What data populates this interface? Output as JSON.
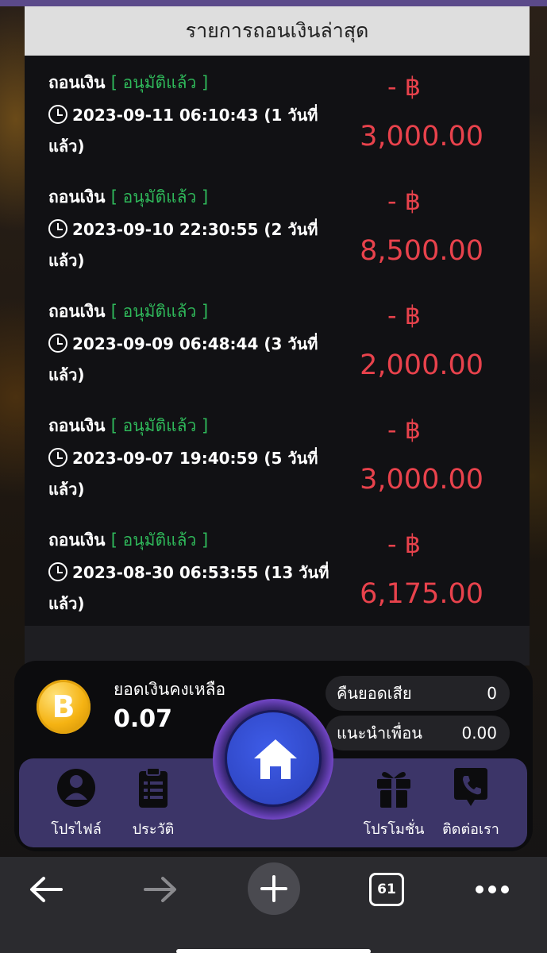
{
  "header": {
    "title": "รายการถอนเงินล่าสุด"
  },
  "transactions": [
    {
      "type": "ถอนเงิน",
      "status": "[ อนุมัติแล้ว ]",
      "datetime": "2023-09-11 06:10:43",
      "ago": "(1 วันที่แล้ว)",
      "sign": "- ฿",
      "amount": "3,000.00"
    },
    {
      "type": "ถอนเงิน",
      "status": "[ อนุมัติแล้ว ]",
      "datetime": "2023-09-10 22:30:55",
      "ago": "(2 วันที่แล้ว)",
      "sign": "- ฿",
      "amount": "8,500.00"
    },
    {
      "type": "ถอนเงิน",
      "status": "[ อนุมัติแล้ว ]",
      "datetime": "2023-09-09 06:48:44",
      "ago": "(3 วันที่แล้ว)",
      "sign": "- ฿",
      "amount": "2,000.00"
    },
    {
      "type": "ถอนเงิน",
      "status": "[ อนุมัติแล้ว ]",
      "datetime": "2023-09-07 19:40:59",
      "ago": "(5 วันที่แล้ว)",
      "sign": "- ฿",
      "amount": "3,000.00"
    },
    {
      "type": "ถอนเงิน",
      "status": "[ อนุมัติแล้ว ]",
      "datetime": "2023-08-30 06:53:55",
      "ago": "(13 วันที่แล้ว)",
      "sign": "- ฿",
      "amount": "6,175.00"
    }
  ],
  "balance": {
    "coin_symbol": "B",
    "label": "ยอดเงินคงเหลือ",
    "value": "0.07"
  },
  "stats": [
    {
      "label": "คืนยอดเสีย",
      "value": "0"
    },
    {
      "label": "แนะนำเพื่อน",
      "value": "0.00"
    }
  ],
  "nav": {
    "profile": "โปรไฟล์",
    "history": "ประวัติ",
    "promotions": "โปรโมชั่น",
    "contact": "ติดต่อเรา"
  },
  "browser": {
    "tab_count": "61"
  },
  "colors": {
    "amount": "#e8424c",
    "status": "#2fb85a",
    "nav_bg": "#3c3568",
    "home": "#3a55e0"
  }
}
